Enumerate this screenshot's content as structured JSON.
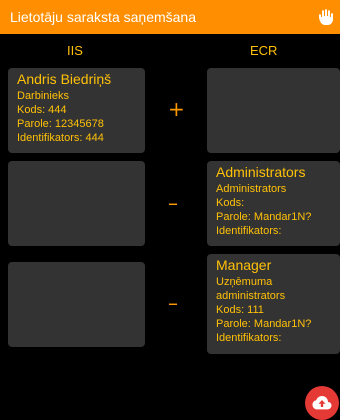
{
  "header": {
    "title": "Lietotāju saraksta saņemšana",
    "hand_icon": "hand-icon"
  },
  "columns": {
    "left": "IIS",
    "right": "ECR"
  },
  "rows": [
    {
      "left": {
        "title": "Andris Biedriņš",
        "lines": [
          "Darbinieks",
          "Kods: 444",
          "Parole: 12345678",
          "Identifikators: 444"
        ]
      },
      "operation": "+",
      "right": null
    },
    {
      "left": null,
      "operation": "–",
      "right": {
        "title": "Administrators",
        "lines": [
          "Administrators",
          "Kods:",
          "Parole: Mandar1N?",
          "Identifikators:"
        ]
      }
    },
    {
      "left": null,
      "operation": "–",
      "right": {
        "title": "Manager",
        "lines": [
          "Uzņēmuma",
          "administrators",
          "Kods: 111",
          "Parole: Mandar1N?",
          "Identifikators:"
        ]
      }
    }
  ],
  "fab": {
    "icon": "cloud-upload-icon"
  },
  "colors": {
    "accent": "#ff8f00",
    "text": "#ffc107",
    "card": "#333333",
    "fab": "#e53935"
  }
}
